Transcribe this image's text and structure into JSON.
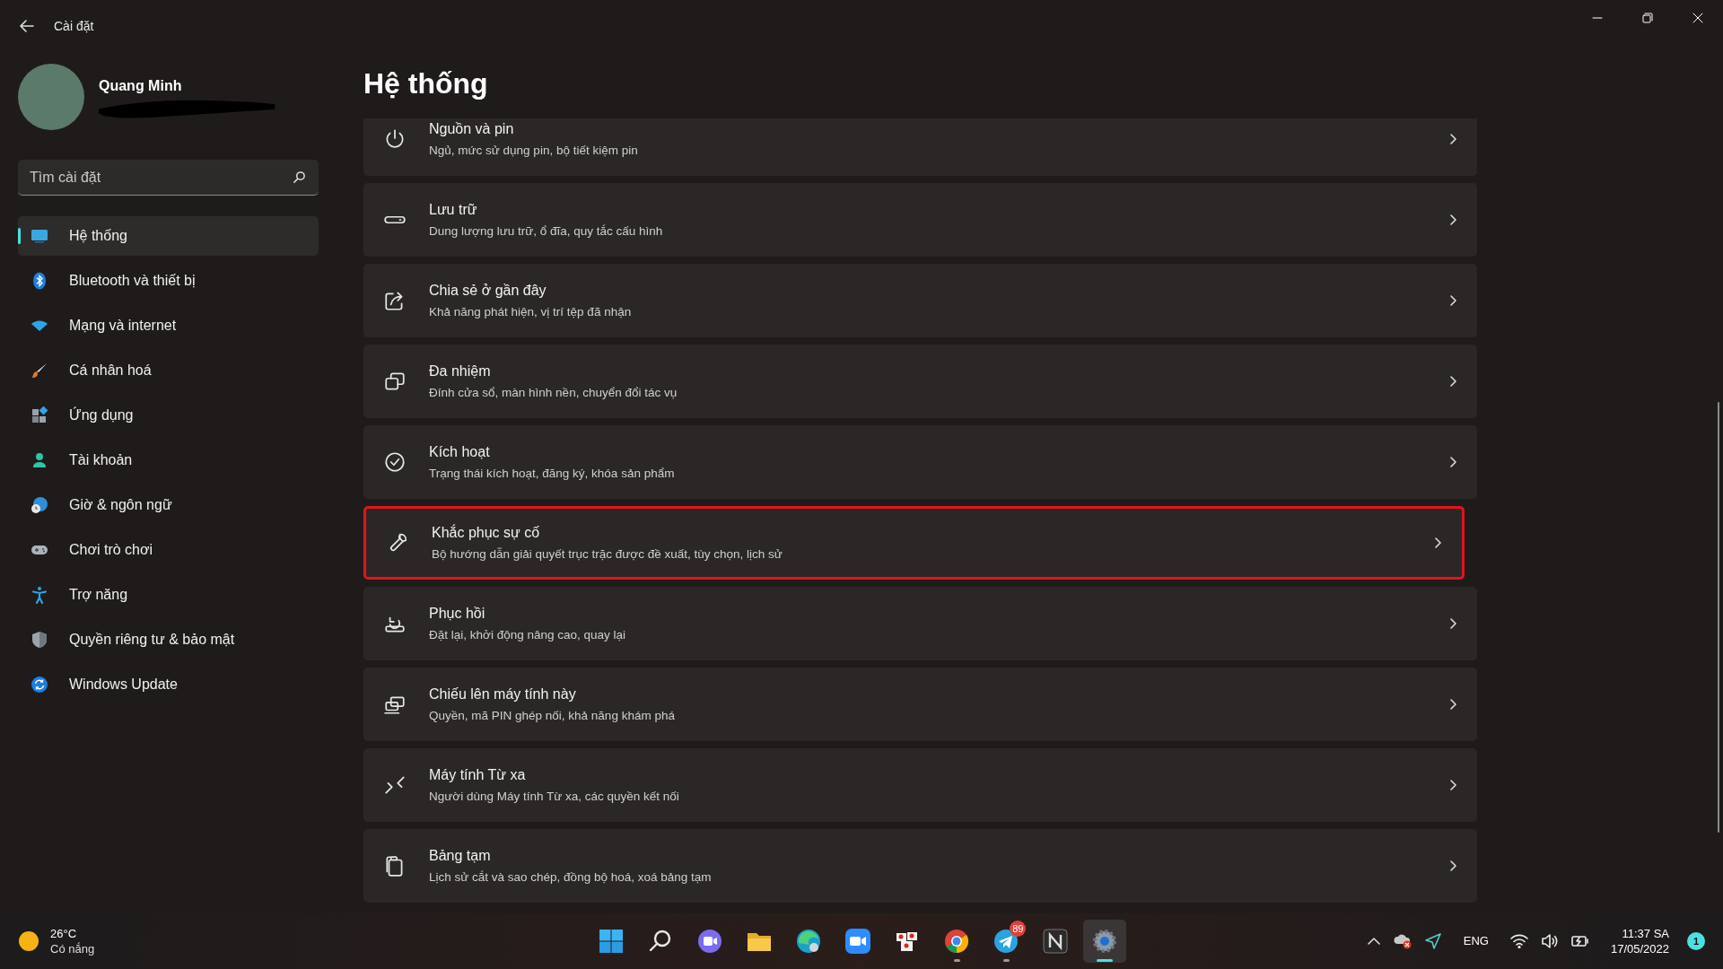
{
  "window": {
    "title": "Cài đặt"
  },
  "user": {
    "name": "Quang Minh"
  },
  "search": {
    "placeholder": "Tìm cài đặt"
  },
  "sidebar": {
    "items": [
      {
        "label": "Hệ thống",
        "selected": true
      },
      {
        "label": "Bluetooth và thiết bị",
        "selected": false
      },
      {
        "label": "Mạng và internet",
        "selected": false
      },
      {
        "label": "Cá nhân hoá",
        "selected": false
      },
      {
        "label": "Ứng dụng",
        "selected": false
      },
      {
        "label": "Tài khoản",
        "selected": false
      },
      {
        "label": "Giờ & ngôn ngữ",
        "selected": false
      },
      {
        "label": "Chơi trò chơi",
        "selected": false
      },
      {
        "label": "Trợ năng",
        "selected": false
      },
      {
        "label": "Quyền riêng tư & bảo mật",
        "selected": false
      },
      {
        "label": "Windows Update",
        "selected": false
      }
    ]
  },
  "page": {
    "title": "Hệ thống",
    "items": [
      {
        "title": "Nguồn và pin",
        "subtitle": "Ngủ, mức sử dụng pin, bộ tiết kiệm pin",
        "highlighted": false
      },
      {
        "title": "Lưu trữ",
        "subtitle": "Dung lượng lưu trữ, ổ đĩa, quy tắc cấu hình",
        "highlighted": false
      },
      {
        "title": "Chia sẻ ở gần đây",
        "subtitle": "Khả năng phát hiện, vị trí tệp đã nhận",
        "highlighted": false
      },
      {
        "title": "Đa nhiệm",
        "subtitle": "Đính cửa sổ, màn hình nền, chuyển đổi tác vụ",
        "highlighted": false
      },
      {
        "title": "Kích hoạt",
        "subtitle": "Trạng thái kích hoạt, đăng ký, khóa sản phẩm",
        "highlighted": false
      },
      {
        "title": "Khắc phục sự cố",
        "subtitle": "Bộ hướng dẫn giải quyết trục trặc được đề xuất, tùy chọn, lịch sử",
        "highlighted": true
      },
      {
        "title": "Phục hồi",
        "subtitle": "Đặt lại, khởi động nâng cao, quay lại",
        "highlighted": false
      },
      {
        "title": "Chiếu lên máy tính này",
        "subtitle": "Quyền, mã PIN ghép nối, khả năng khám phá",
        "highlighted": false
      },
      {
        "title": "Máy tính Từ xa",
        "subtitle": "Người dùng Máy tính Từ xa, các quyền kết nối",
        "highlighted": false
      },
      {
        "title": "Bảng tạm",
        "subtitle": "Lịch sử cắt và sao chép, đồng bộ hoá, xoá bảng tạm",
        "highlighted": false
      }
    ]
  },
  "taskbar": {
    "weather": {
      "temperature": "26°C",
      "condition": "Có nắng"
    },
    "apps": [
      {
        "running": false,
        "active": false
      },
      {
        "running": false,
        "active": false
      },
      {
        "running": false,
        "active": false
      },
      {
        "running": false,
        "active": false
      },
      {
        "running": false,
        "active": false
      },
      {
        "running": false,
        "active": false
      },
      {
        "running": false,
        "active": false
      },
      {
        "running": true,
        "active": false
      },
      {
        "running": true,
        "active": false,
        "badge": "89"
      },
      {
        "running": false,
        "active": false
      },
      {
        "running": true,
        "active": true
      }
    ],
    "language": "ENG",
    "time": "11:37 SA",
    "date": "17/05/2022",
    "notifications": "1"
  }
}
